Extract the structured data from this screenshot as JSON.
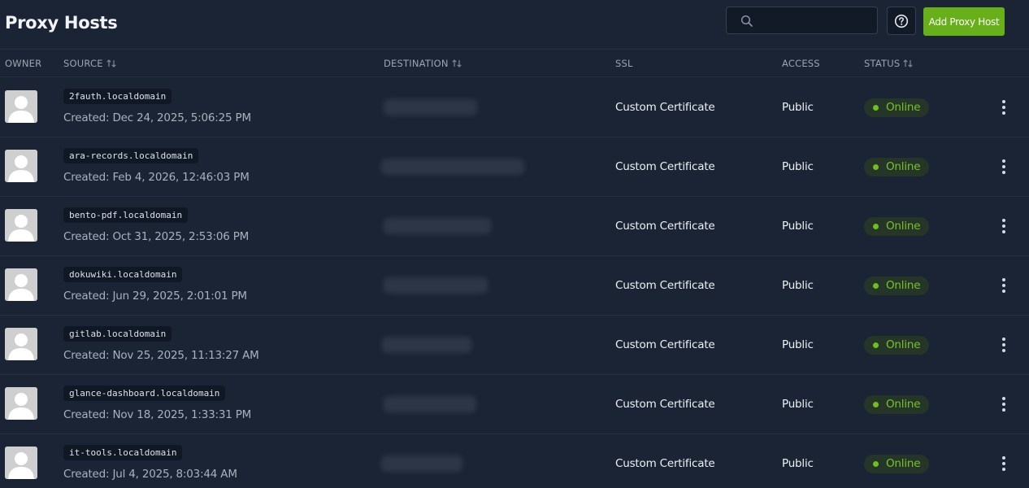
{
  "header": {
    "title": "Proxy Hosts",
    "search_placeholder": "",
    "help_icon": "help-circle-icon",
    "add_button_label": "Add Proxy Host"
  },
  "columns": {
    "owner": "OWNER",
    "source": "SOURCE",
    "destination": "DESTINATION",
    "ssl": "SSL",
    "access": "ACCESS",
    "status": "STATUS"
  },
  "colors": {
    "background": "#1b2434",
    "accent": "#67b01a",
    "online": "#78c325"
  },
  "rows": [
    {
      "source": "2fauth.localdomain",
      "created": "Created: Dec 24, 2025, 5:06:25 PM",
      "ssl": "Custom Certificate",
      "access": "Public",
      "status": "Online"
    },
    {
      "source": "ara-records.localdomain",
      "created": "Created: Feb 4, 2026, 12:46:03 PM",
      "ssl": "Custom Certificate",
      "access": "Public",
      "status": "Online"
    },
    {
      "source": "bento-pdf.localdomain",
      "created": "Created: Oct 31, 2025, 2:53:06 PM",
      "ssl": "Custom Certificate",
      "access": "Public",
      "status": "Online"
    },
    {
      "source": "dokuwiki.localdomain",
      "created": "Created: Jun 29, 2025, 2:01:01 PM",
      "ssl": "Custom Certificate",
      "access": "Public",
      "status": "Online"
    },
    {
      "source": "gitlab.localdomain",
      "created": "Created: Nov 25, 2025, 11:13:27 AM",
      "ssl": "Custom Certificate",
      "access": "Public",
      "status": "Online"
    },
    {
      "source": "glance-dashboard.localdomain",
      "created": "Created: Nov 18, 2025, 1:33:31 PM",
      "ssl": "Custom Certificate",
      "access": "Public",
      "status": "Online"
    },
    {
      "source": "it-tools.localdomain",
      "created": "Created: Jul 4, 2025, 8:03:44 AM",
      "ssl": "Custom Certificate",
      "access": "Public",
      "status": "Online"
    }
  ]
}
